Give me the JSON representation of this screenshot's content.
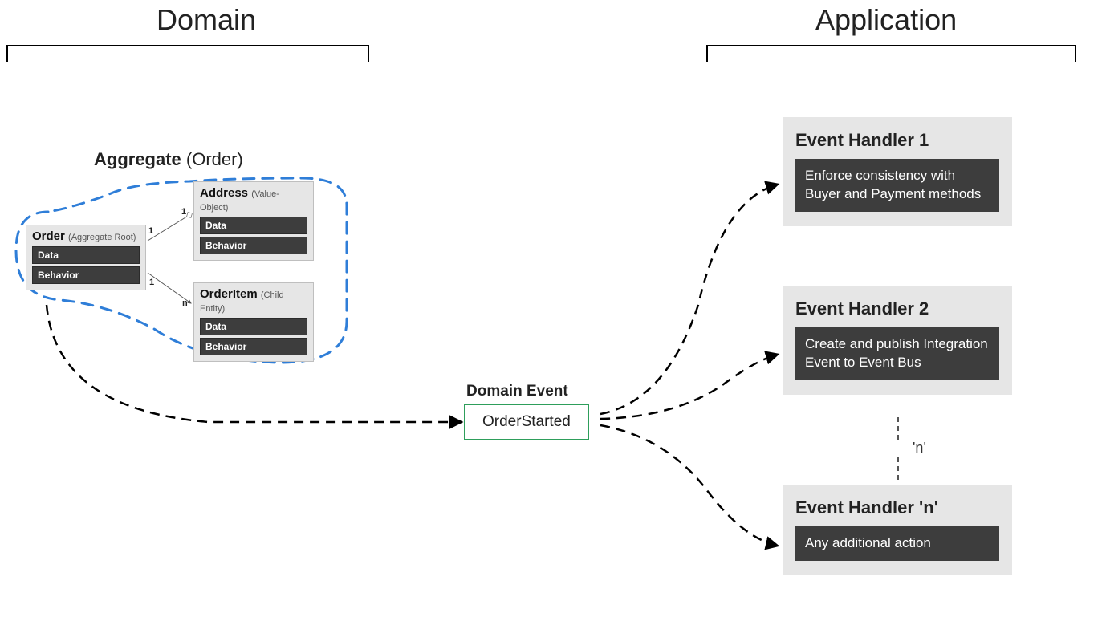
{
  "sections": {
    "domain": "Domain",
    "application": "Application"
  },
  "aggregate": {
    "label_bold": "Aggregate",
    "label_paren": "(Order)",
    "entities": {
      "order": {
        "name": "Order",
        "stereotype": "(Aggregate Root)",
        "data": "Data",
        "behavior": "Behavior"
      },
      "address": {
        "name": "Address",
        "stereotype": "(Value-Object)",
        "data": "Data",
        "behavior": "Behavior"
      },
      "orderItem": {
        "name": "OrderItem",
        "stereotype": "(Child Entity)",
        "data": "Data",
        "behavior": "Behavior"
      }
    },
    "cardinality": {
      "one_a": "1",
      "one_b": "1",
      "one_c": "1",
      "n": "n"
    }
  },
  "domainEvent": {
    "heading": "Domain Event",
    "name": "OrderStarted"
  },
  "handlers": {
    "h1": {
      "title": "Event Handler 1",
      "body": "Enforce consistency with Buyer and Payment methods"
    },
    "h2": {
      "title": "Event Handler 2",
      "body": "Create and publish Integration Event to Event Bus"
    },
    "hn": {
      "title": "Event Handler 'n'",
      "body": "Any additional action"
    },
    "n_label": "'n'"
  }
}
